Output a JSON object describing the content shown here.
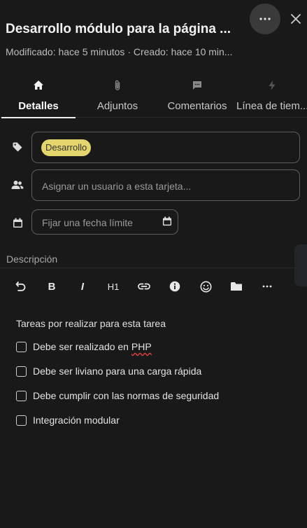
{
  "header": {
    "title": "Desarrollo módulo para la página ...",
    "subtitle": "Modificado: hace 5 minutos · Creado: hace 10 min...",
    "more_icon": "ellipsis-icon",
    "close_icon": "close-icon"
  },
  "tabs": [
    {
      "label": "Detalles",
      "icon": "home-icon",
      "active": true
    },
    {
      "label": "Adjuntos",
      "icon": "paperclip-icon"
    },
    {
      "label": "Comentarios",
      "icon": "comment-icon"
    },
    {
      "label": "Línea de tiem...",
      "icon": "lightning-icon"
    }
  ],
  "details": {
    "tag": "Desarrollo",
    "tag_color": "#e5d56d",
    "assign_placeholder": "Asignar un usuario a esta tarjeta...",
    "due_placeholder": "Fijar una fecha límite"
  },
  "description": {
    "label": "Descripción",
    "toolbar": {
      "undo_icon": "undo-icon",
      "bold": "B",
      "italic": "I",
      "heading": "H1",
      "link_icon": "link-icon",
      "info_icon": "info-icon",
      "emoji_icon": "emoji-icon",
      "folder_icon": "folder-icon",
      "more_icon": "ellipsis-icon"
    },
    "heading": "Tareas por realizar para esta tarea",
    "tasks": [
      {
        "pre": "Debe ser realizado en ",
        "marked": "PHP",
        "checked": false
      },
      {
        "label": "Debe ser liviano para una carga rápida",
        "checked": false
      },
      {
        "label": "Debe cumplir con las normas de seguridad",
        "checked": false
      },
      {
        "label": "Integración modular",
        "checked": false
      }
    ]
  }
}
